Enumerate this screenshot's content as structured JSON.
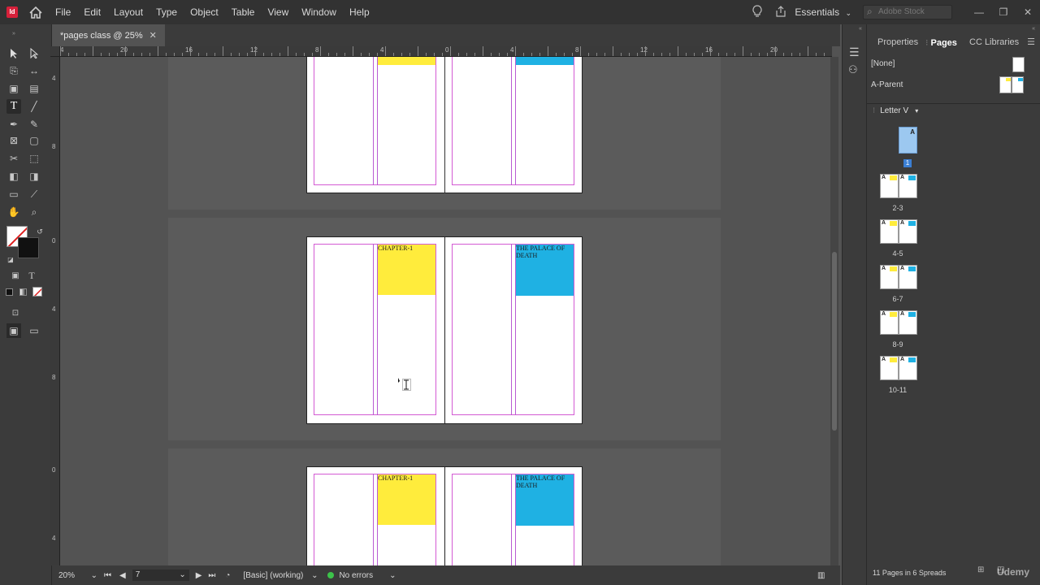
{
  "menu": {
    "app_icon": "Id",
    "items": [
      "File",
      "Edit",
      "Layout",
      "Type",
      "Object",
      "Table",
      "View",
      "Window",
      "Help"
    ],
    "workspace": "Essentials",
    "stock_placeholder": "Adobe Stock"
  },
  "document": {
    "tab_title": "*pages class @ 25%",
    "close_glyph": "✕"
  },
  "ruler": {
    "h_labels": [
      "4",
      "20",
      "16",
      "12",
      "8",
      "4",
      "0",
      "4",
      "8",
      "12",
      "16",
      "20"
    ],
    "v_labels": [
      "4",
      "8",
      "0",
      "4",
      "8",
      "0",
      "4"
    ]
  },
  "spreads": [
    {
      "chapter_text": "",
      "blue_text": ""
    },
    {
      "chapter_text": "CHAPTER-1",
      "blue_text": "THE PALACE OF DEATH"
    },
    {
      "chapter_text": "CHAPTER-1",
      "blue_text": "THE PALACE OF DEATH"
    }
  ],
  "status": {
    "zoom": "20%",
    "page_number": "7",
    "style": "[Basic] (working)",
    "errors": "No errors"
  },
  "panel": {
    "tabs": [
      "Properties",
      "Pages",
      "CC Libraries"
    ],
    "active_tab": "Pages",
    "parents": [
      "[None]",
      "A-Parent"
    ],
    "size_label": "Letter V",
    "first_page_label": "1",
    "first_page_prefix": "A",
    "spread_labels": [
      "2-3",
      "4-5",
      "6-7",
      "8-9",
      "10-11"
    ],
    "spread_prefix": "A",
    "footer": "11 Pages in 6 Spreads"
  },
  "colors": {
    "yellow_frame": "#ffec3c",
    "blue_frame": "#1fb1e3",
    "margin_guide": "#d35bd3",
    "no_error_dot": "#3cc34a"
  },
  "watermark": "Udemy"
}
